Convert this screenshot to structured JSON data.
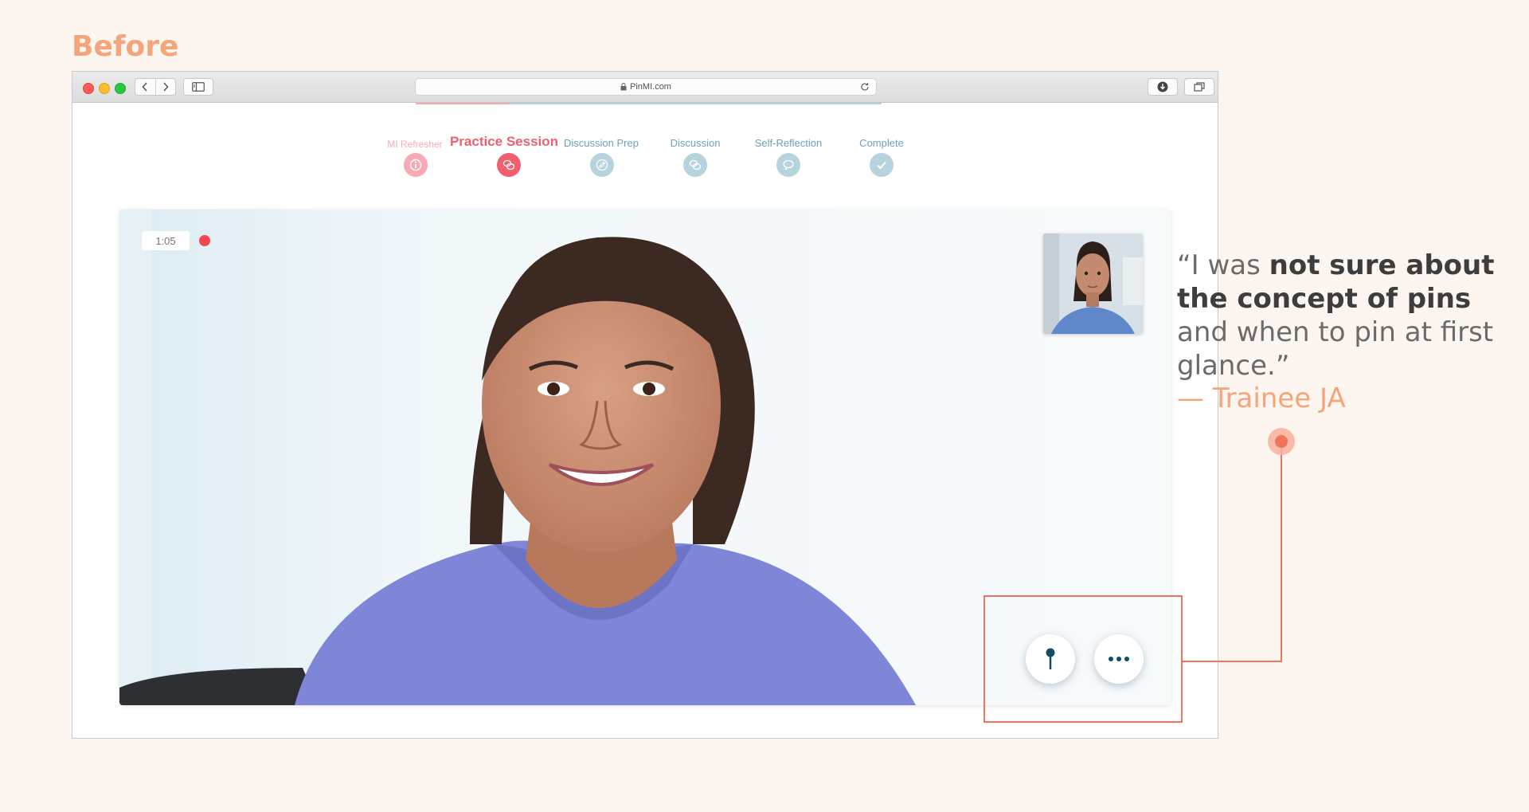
{
  "heading": "Before",
  "browser": {
    "url": "PinMI.com"
  },
  "steps": [
    {
      "label": "MI Refresher",
      "state": "done",
      "icon": "info-icon"
    },
    {
      "label": "Practice Session",
      "state": "current",
      "icon": "chat-icon"
    },
    {
      "label": "Discussion Prep",
      "state": "upcoming",
      "icon": "pencil-icon"
    },
    {
      "label": "Discussion",
      "state": "upcoming",
      "icon": "chat-icon"
    },
    {
      "label": "Self-Reflection",
      "state": "upcoming",
      "icon": "thought-icon"
    },
    {
      "label": "Complete",
      "state": "upcoming",
      "icon": "check-icon"
    }
  ],
  "session": {
    "timer": "1:05"
  },
  "controls": {
    "pin_icon": "pin-icon",
    "more_icon": "more-icon"
  },
  "quote": {
    "part1": "“I was ",
    "bold1": "not sure about the concept of pins",
    "part2": " and when to pin at first glance.”",
    "attribution": "— Trainee JA"
  },
  "colors": {
    "accent_done": "#f7a9b4",
    "accent_current": "#ef5f70",
    "upcoming": "#b7d4de",
    "callout": "#f0735a",
    "heading": "#f5a57a"
  }
}
